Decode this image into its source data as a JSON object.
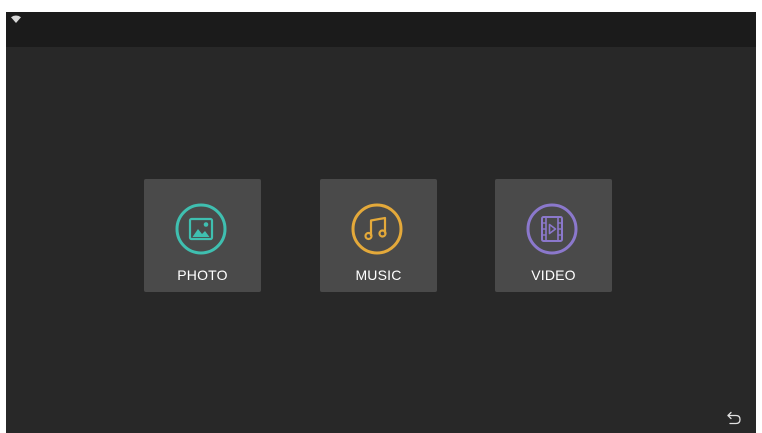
{
  "status_bar": {
    "wifi_icon": "wifi-icon"
  },
  "menu": {
    "items": [
      {
        "label": "PHOTO",
        "icon": "image-icon",
        "color": "#3fbfb0"
      },
      {
        "label": "MUSIC",
        "icon": "music-note-icon",
        "color": "#e4a93a"
      },
      {
        "label": "VIDEO",
        "icon": "film-play-icon",
        "color": "#8b78cc"
      }
    ]
  },
  "navigation": {
    "back_icon": "back-arrow-icon"
  },
  "colors": {
    "background": "#282828",
    "status_bar": "#1b1b1b",
    "tile": "#4a4a4a",
    "text": "#ffffff"
  }
}
